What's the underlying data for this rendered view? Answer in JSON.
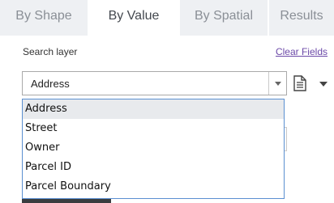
{
  "tabs": [
    {
      "label": "By Shape",
      "active": false
    },
    {
      "label": "By Value",
      "active": true
    },
    {
      "label": "By Spatial",
      "active": false
    },
    {
      "label": "Results",
      "active": false
    }
  ],
  "search": {
    "label": "Search layer",
    "clear_link": "Clear Fields",
    "selected_value": "Address"
  },
  "dropdown": {
    "options": [
      "Address",
      "Street",
      "Owner",
      "Parcel ID",
      "Parcel Boundary"
    ],
    "highlighted_index": 0
  },
  "icons": {
    "select_arrow": "chevron-down-icon",
    "document": "document-icon",
    "document_menu_arrow": "caret-down-icon"
  },
  "colors": {
    "link": "#6c4aa8",
    "tab_inactive_bg": "#eef0f3",
    "dropdown_border": "#5b8fd1",
    "highlight_bg": "#e8eaed"
  }
}
